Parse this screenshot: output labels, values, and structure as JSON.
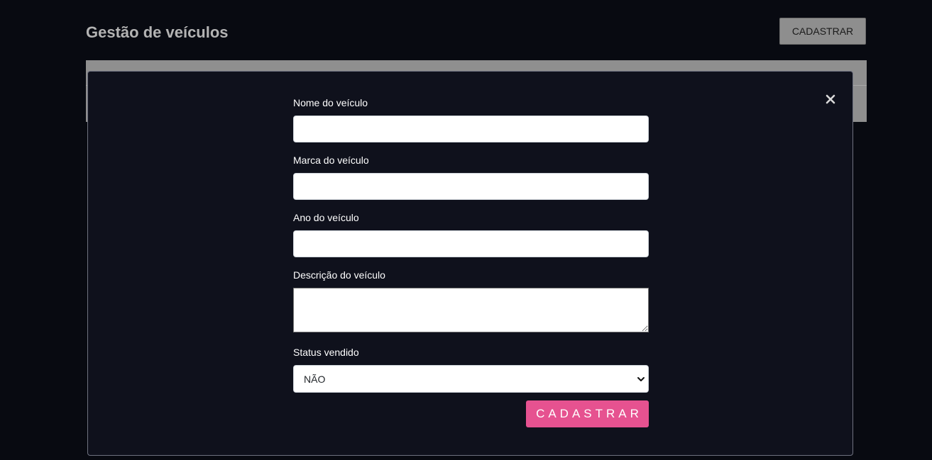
{
  "header": {
    "title": "Gestão de veículos",
    "register_button": "CADASTRAR"
  },
  "modal": {
    "close_icon": "close-icon",
    "fields": {
      "name": {
        "label": "Nome do veículo",
        "value": "",
        "placeholder": ""
      },
      "brand": {
        "label": "Marca do veículo",
        "value": "",
        "placeholder": ""
      },
      "year": {
        "label": "Ano do veículo",
        "value": "",
        "placeholder": ""
      },
      "description": {
        "label": "Descrição do veículo",
        "value": ""
      },
      "status": {
        "label": "Status vendido",
        "selected": "NÃO"
      }
    },
    "submit_label": "CADASTRAR"
  },
  "colors": {
    "background": "#080a11",
    "modal_background": "#0f111c",
    "submit_button": "#e65290",
    "header_button": "#8e8e8e",
    "title": "#b3b3b3"
  }
}
